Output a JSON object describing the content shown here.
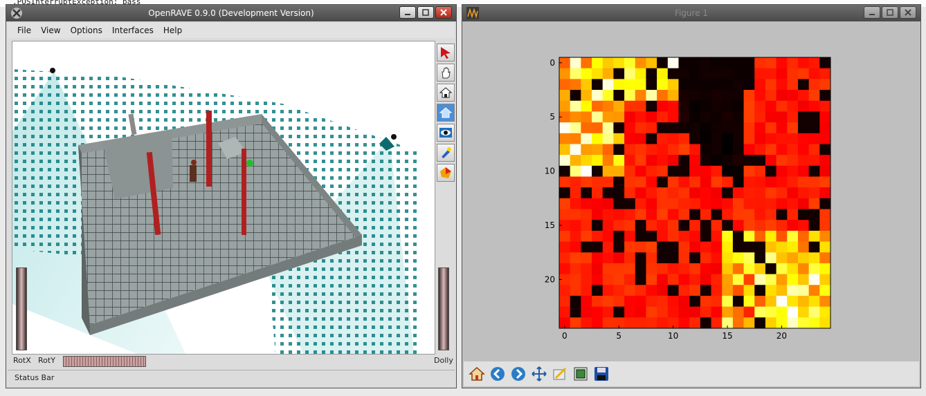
{
  "terminal": {
    "text": ".POSInterruptException: pass"
  },
  "window1": {
    "title": "OpenRAVE 0.9.0 (Development Version)",
    "menu": [
      {
        "label": "File",
        "u": "F"
      },
      {
        "label": "View",
        "u": "V"
      },
      {
        "label": "Options",
        "u": "O"
      },
      {
        "label": "Interfaces",
        "u": "I"
      },
      {
        "label": "Help",
        "u": "H"
      }
    ],
    "rotx_label": "RotX",
    "roty_label": "RotY",
    "dolly_label": "Dolly",
    "status": "Status Bar",
    "tools": [
      "select-arrow-icon",
      "pan-hand-icon",
      "home-view-icon",
      "seek-view-icon",
      "view-all-icon",
      "headlight-icon",
      "perspective-icon"
    ]
  },
  "window2": {
    "title": "Figure 1",
    "xticks": [
      "0",
      "5",
      "10",
      "15",
      "20"
    ],
    "yticks": [
      "0",
      "5",
      "10",
      "15",
      "20"
    ],
    "tools": [
      "home-icon",
      "back-icon",
      "forward-icon",
      "pan-icon",
      "zoom-icon",
      "subplots-icon",
      "save-icon"
    ]
  },
  "chart_data": {
    "type": "heatmap",
    "colormap": "hot",
    "xlim": [
      -0.5,
      24.5
    ],
    "ylim": [
      24.5,
      -0.5
    ],
    "xticks": [
      0,
      5,
      10,
      15,
      20
    ],
    "yticks": [
      0,
      5,
      10,
      15,
      20
    ],
    "size": [
      25,
      25
    ],
    "note_values": "normalized intensity 0-1 estimated per cell"
  }
}
